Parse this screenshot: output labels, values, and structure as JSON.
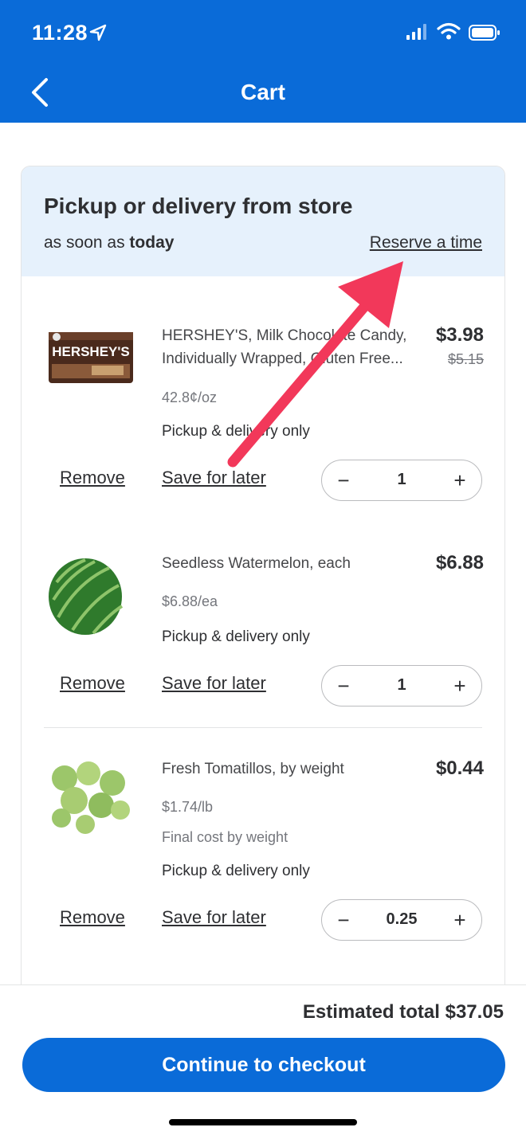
{
  "status_bar": {
    "time": "11:28"
  },
  "header": {
    "title": "Cart"
  },
  "banner": {
    "title": "Pickup or delivery from store",
    "soon_prefix": "as soon as",
    "soon_day": "today",
    "reserve_label": "Reserve a time"
  },
  "items": [
    {
      "name": "HERSHEY'S, Milk Chocolate Candy, Individually Wrapped, Gluten Free...",
      "price": "$3.98",
      "was_price": "$5.15",
      "unit_price": "42.8¢/oz",
      "fulfillment": "Pickup & delivery only",
      "remove_label": "Remove",
      "save_label": "Save for later",
      "quantity": "1",
      "image_text": "HERSHEY'S"
    },
    {
      "name": "Seedless Watermelon, each",
      "price": "$6.88",
      "unit_price": "$6.88/ea",
      "fulfillment": "Pickup & delivery only",
      "remove_label": "Remove",
      "save_label": "Save for later",
      "quantity": "1"
    },
    {
      "name": "Fresh Tomatillos, by weight",
      "price": "$0.44",
      "unit_price": "$1.74/lb",
      "note": "Final cost by weight",
      "fulfillment": "Pickup & delivery only",
      "remove_label": "Remove",
      "save_label": "Save for later",
      "quantity": "0.25"
    }
  ],
  "stepper": {
    "minus": "−",
    "plus": "+"
  },
  "footer": {
    "total": "Estimated total $37.05",
    "checkout_label": "Continue to checkout"
  },
  "colors": {
    "brand_blue": "#0a6bd8",
    "banner_bg": "#e6f1fc",
    "annotation_arrow": "#f2385a"
  }
}
